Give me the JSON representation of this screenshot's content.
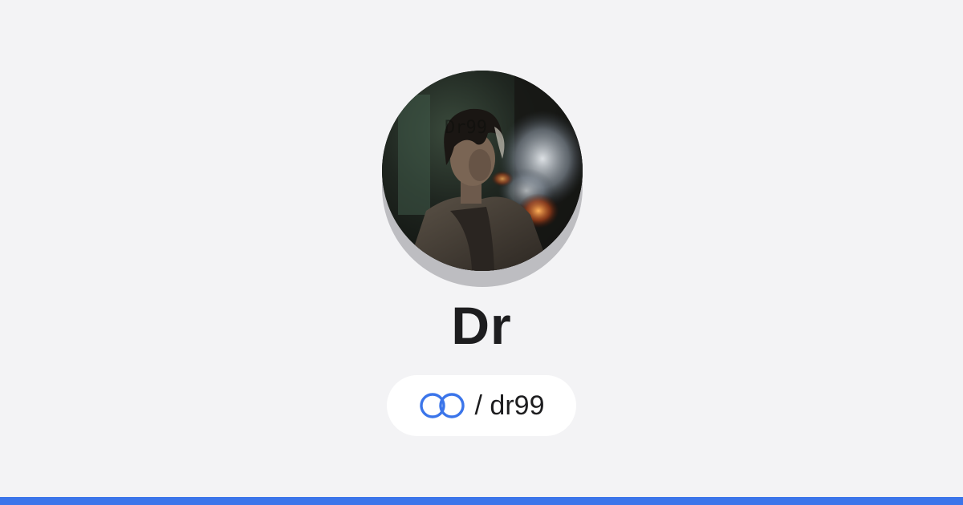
{
  "profile": {
    "display_name": "Dr",
    "handle_separator": "/",
    "handle": "dr99",
    "avatar_alt": "Dr99"
  },
  "icons": {
    "link": "link-rings-icon"
  },
  "colors": {
    "background": "#f3f3f5",
    "accent": "#3b75ea",
    "text": "#1d1d1f",
    "pill": "#ffffff"
  }
}
